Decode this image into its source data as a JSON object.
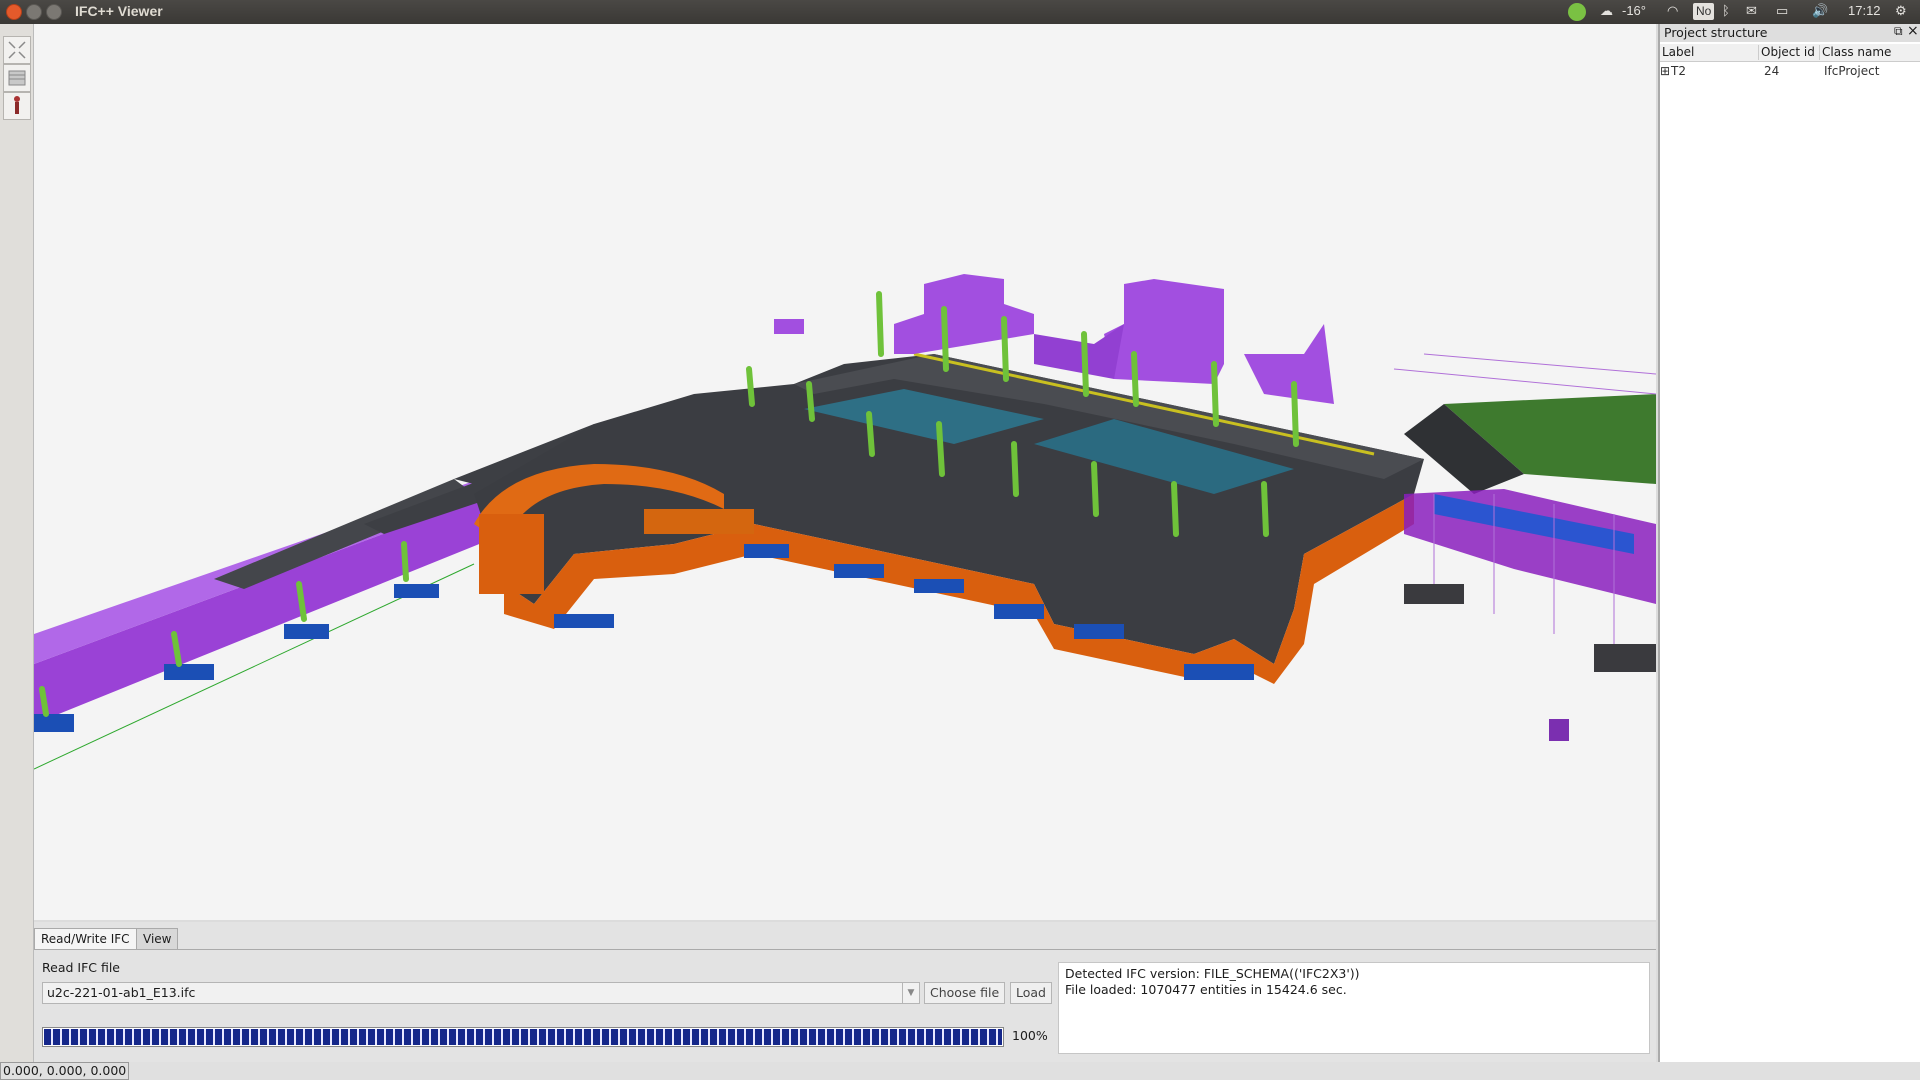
{
  "titlebar": {
    "app_title": "IFC++ Viewer",
    "tray": {
      "weather": "-16°",
      "badge": "No",
      "clock": "17:12"
    }
  },
  "left_toolbar": {
    "tools": [
      "zoom-extents-icon",
      "view-mode-icon",
      "person-icon"
    ]
  },
  "bottom_panel": {
    "tabs": [
      "Read/Write IFC",
      "View"
    ],
    "active_tab": "Read/Write IFC",
    "read_label": "Read IFC file",
    "file_value": "u2c-221-01-ab1_E13.ifc",
    "choose_button": "Choose file",
    "load_button": "Load",
    "progress_percent": 100,
    "progress_text": "100%",
    "log": [
      "Detected IFC version: FILE_SCHEMA(('IFC2X3'))",
      "File loaded: 1070477 entities in 15424.6 sec."
    ]
  },
  "project_structure": {
    "title": "Project structure",
    "columns": [
      "Label",
      "Object id",
      "Class name"
    ],
    "rows": [
      {
        "expander": "⊞",
        "label": "T2",
        "object_id": "24",
        "class_name": "IfcProject"
      }
    ]
  },
  "statusbar": {
    "coords": "0.000, 0.000, 0.000"
  },
  "colors": {
    "slab": "#3d3f44",
    "wall_orange": "#d95f0e",
    "wall_purple": "#a24fe0",
    "column_green": "#6fc23a",
    "footing_blue": "#1b4fb5",
    "floor_teal": "#2e6f85",
    "roof_green": "#3e7a2e"
  }
}
